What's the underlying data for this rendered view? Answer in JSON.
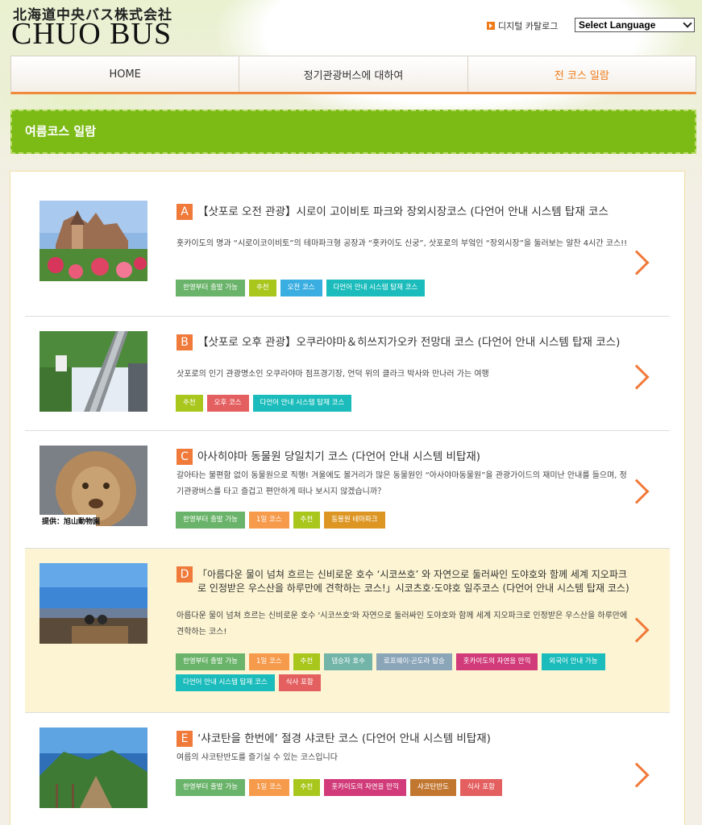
{
  "header": {
    "logo_jp": "北海道中央バス株式会社",
    "logo_en": "CHUO BUS",
    "catalog_label": "디지털 카탈로그",
    "language_select": "Select Language"
  },
  "nav": [
    {
      "label": "HOME"
    },
    {
      "label": "정기관광버스에 대하여"
    },
    {
      "label": "전 코스 일람"
    }
  ],
  "section_title": "여름코스 일람",
  "colors": {
    "accent": "#f07a3a",
    "season_bar": "#7cbb16",
    "tag_green": "#6ab36a",
    "tag_olive": "#a9c61d",
    "tag_blue": "#3aaee0",
    "tag_teal": "#1bbcbb",
    "tag_red": "#e46060",
    "tag_orange": "#f69a4c",
    "tag_gold": "#dd9624",
    "tag_slateblue": "#7fa4b6",
    "tag_magenta": "#d13b79",
    "tag_brown": "#c27730"
  },
  "courses": [
    {
      "letter": "A",
      "title": "【삿포로 오전 관광】시로이 고이비토 파크와 장외시장코스 (다언어 안내 시스템 탑재 코스",
      "desc": "홋카이도의 명과 “시로이코이비토”의 테마파크형 공장과 “홋카이도 신궁”, 삿포로의 부엌인 “장외시장”을 둘러보는 알찬 4시간 코스!!",
      "tags": [
        {
          "label": "한영부터 출발 가능",
          "color": "#6ab36a"
        },
        {
          "label": "추천",
          "color": "#a9c61d"
        },
        {
          "label": "오전 코스",
          "color": "#3aaee0"
        },
        {
          "label": "다언어 안내 시스템 탑재 코스",
          "color": "#1bbcbb"
        }
      ]
    },
    {
      "letter": "B",
      "title": "【삿포로 오후 관광】오쿠라야마＆히쓰지가오카 전망대 코스 (다언어 안내 시스템 탑재 코스)",
      "desc": "삿포로의 인기 관광명소인 오쿠라야마 점프경기장, 언덕 위의 클라크 박사와 만나러 가는 여행",
      "tags": [
        {
          "label": "추천",
          "color": "#a9c61d"
        },
        {
          "label": "오후 코스",
          "color": "#e46060"
        },
        {
          "label": "다언어 안내 시스템 탑재 코스",
          "color": "#1bbcbb"
        }
      ]
    },
    {
      "letter": "C",
      "title": "아사히야마 동물원 당일치기 코스 (다언어 안내 시스템 비탑재)",
      "desc": "갈아타는 불편함 없이 동물원으로 직행! 겨울에도 볼거리가 많은 동물원인 “아사야마동물원”을 관광가이드의 재미난 안내를 들으며, 정기관광버스를 타고 즐겁고 편안하게 떠나 보시지 않겠습니까？",
      "thumb_caption": "提供：旭山動物園",
      "tags": [
        {
          "label": "한영부터 출발 가능",
          "color": "#6ab36a"
        },
        {
          "label": "1일 코스",
          "color": "#f69a4c"
        },
        {
          "label": "추천",
          "color": "#a9c61d"
        },
        {
          "label": "동물원 테마파크",
          "color": "#dd9624"
        }
      ]
    },
    {
      "letter": "D",
      "title": "「아름다운 물이 넘쳐 흐르는 신비로운 호수 ‘시코쓰호’ 와 자연으로 둘러싸인 도야호와 함께 세계 지오파크로 인정받은 우스산을 하루만에 견학하는 코스!」시코츠호·도야호 일주코스 (다언어 안내 시스템 탑재 코스)",
      "desc": "아름다운 물이 넘쳐 흐르는 신비로운 호수 '시코쓰호'와 자연으로 둘러싸인 도야호와 함께 세계 지오파크로 인정받은 우스산을 하루만에 견학하는 코스!",
      "tags": [
        {
          "label": "한영부터 출발 가능",
          "color": "#6ab36a"
        },
        {
          "label": "1일 코스",
          "color": "#f69a4c"
        },
        {
          "label": "추천",
          "color": "#a9c61d"
        },
        {
          "label": "댐승자 호수",
          "color": "#72b4a8"
        },
        {
          "label": "로프웨이·곤도라 탑승",
          "color": "#8aa4b8"
        },
        {
          "label": "홋카이도의 자연을 만끽",
          "color": "#d13b79"
        },
        {
          "label": "외국어 안내 가능",
          "color": "#1bbcbb"
        },
        {
          "label": "다언어 안내 시스템 탑재 코스",
          "color": "#1bbcbb"
        },
        {
          "label": "식사 포함",
          "color": "#e46060"
        }
      ]
    },
    {
      "letter": "E",
      "title": "‘샤코탄을 한번에’ 절경 샤코탄 코스 (다언어 안내 시스템 비탑재)",
      "desc": "여름의 샤코탄반도를 즐기실 수 있는 코스입니다",
      "tags": [
        {
          "label": "한영부터 출발 가능",
          "color": "#6ab36a"
        },
        {
          "label": "1일 코스",
          "color": "#f69a4c"
        },
        {
          "label": "추천",
          "color": "#a9c61d"
        },
        {
          "label": "홋카이도의 자연을 만끽",
          "color": "#d13b79"
        },
        {
          "label": "샤코탄반도",
          "color": "#c27730"
        },
        {
          "label": "식사 포함",
          "color": "#e46060"
        }
      ]
    }
  ]
}
